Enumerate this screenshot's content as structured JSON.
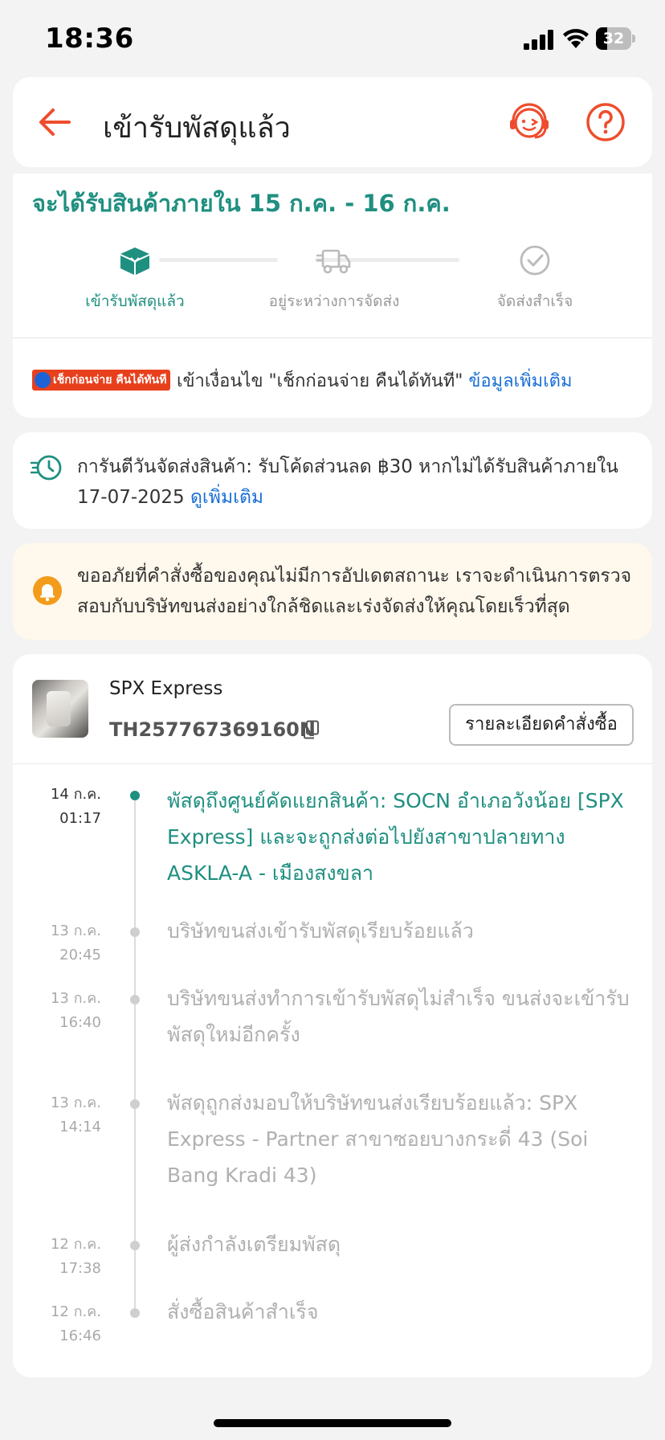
{
  "status_bar": {
    "time": "18:36",
    "battery_level": "32",
    "battery_fraction": 0.32
  },
  "header": {
    "title": "เข้ารับพัสดุแล้ว",
    "accent_color": "#ee4d2d"
  },
  "delivery": {
    "estimate": "จะได้รับสินค้าภายใน 15 ก.ค. - 16 ก.ค.",
    "steps": [
      {
        "label": "เข้ารับพัสดุแล้ว",
        "icon": "box-icon",
        "active": true
      },
      {
        "label": "อยู่ระหว่างการจัดส่ง",
        "icon": "truck-icon",
        "active": false
      },
      {
        "label": "จัดส่งสำเร็จ",
        "icon": "check-circle-icon",
        "active": false
      }
    ],
    "promo": {
      "badge": "เช็กก่อนจ่าย คืนได้ทันที",
      "text": "เข้าเงื่อนไข \"เช็กก่อนจ่าย คืนได้ทันที\"",
      "link": "ข้อมูลเพิ่มเติม"
    },
    "teal_color": "#1f8f80"
  },
  "guarantee": {
    "text": "การันตีวันจัดส่งสินค้า: รับโค้ดส่วนลด ฿30 หากไม่ได้รับสินค้าภายใน 17-07-2025",
    "link": "ดูเพิ่มเติม"
  },
  "notice": {
    "text": "ขออภัยที่คำสั่งซื้อของคุณไม่มีการอัปเดตสถานะ เราจะดำเนินการตรวจสอบกับบริษัทขนส่งอย่างใกล้ชิดและเร่งจัดส่งให้คุณโดยเร็วที่สุด"
  },
  "shipment": {
    "carrier": "SPX Express",
    "tracking_number": "TH257767369160N",
    "order_detail_button": "รายละเอียดคำสั่งซื้อ",
    "events": [
      {
        "date": "14 ก.ค.",
        "time": "01:17",
        "text": "พัสดุถึงศูนย์คัดแยกสินค้า: SOCN อำเภอวังน้อย [SPX Express] และจะถูกส่งต่อไปยังสาขาปลายทาง ASKLA-A - เมืองสงขลา",
        "active": true
      },
      {
        "date": "13 ก.ค.",
        "time": "20:45",
        "text": "บริษัทขนส่งเข้ารับพัสดุเรียบร้อยแล้ว",
        "active": false
      },
      {
        "date": "13 ก.ค.",
        "time": "16:40",
        "text": "บริษัทขนส่งทำการเข้ารับพัสดุไม่สำเร็จ ขนส่งจะเข้ารับพัสดุใหม่อีกครั้ง",
        "active": false
      },
      {
        "date": "13 ก.ค.",
        "time": "14:14",
        "text": "พัสดุถูกส่งมอบให้บริษัทขนส่งเรียบร้อยแล้ว: SPX Express - Partner สาขาซอยบางกระดี่ 43  (Soi Bang Kradi 43)",
        "active": false
      },
      {
        "date": "12 ก.ค.",
        "time": "17:38",
        "text": " ผู้ส่งกำลังเตรียมพัสดุ",
        "active": false
      },
      {
        "date": "12 ก.ค.",
        "time": "16:46",
        "text": "สั่งซื้อสินค้าสำเร็จ",
        "active": false
      }
    ]
  }
}
